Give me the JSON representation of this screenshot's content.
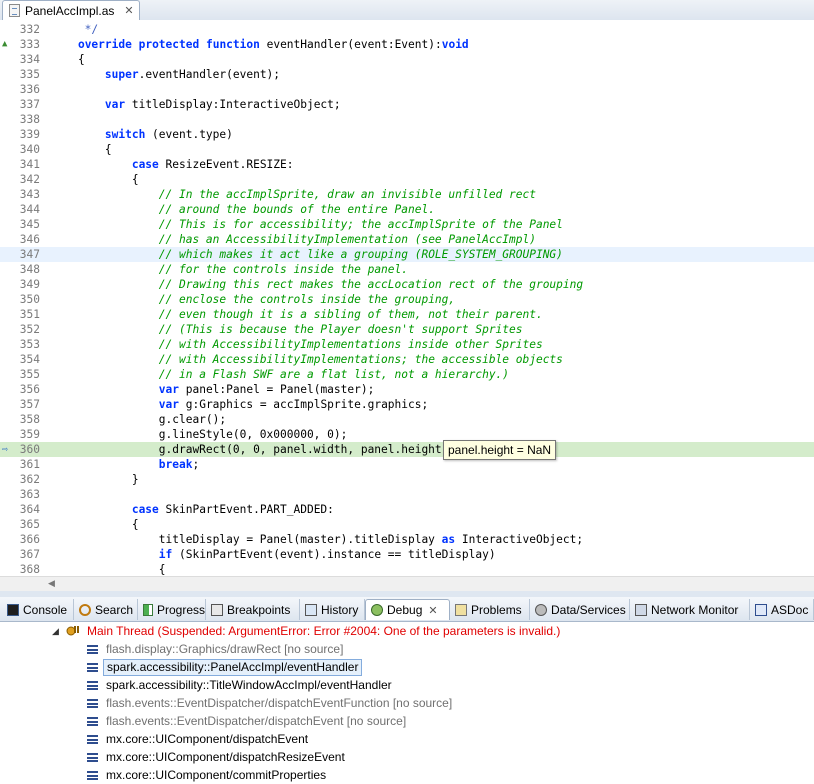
{
  "editor_tab": {
    "title": "PanelAccImpl.as",
    "close": "✕"
  },
  "code_lines": [
    {
      "num": "332",
      "text": "     */"
    },
    {
      "num": "333",
      "text": "    override protected function eventHandler(event:Event):void"
    },
    {
      "num": "334",
      "text": "    {"
    },
    {
      "num": "335",
      "text": "        super.eventHandler(event);"
    },
    {
      "num": "336",
      "text": ""
    },
    {
      "num": "337",
      "text": "        var titleDisplay:InteractiveObject;"
    },
    {
      "num": "338",
      "text": ""
    },
    {
      "num": "339",
      "text": "        switch (event.type)"
    },
    {
      "num": "340",
      "text": "        {"
    },
    {
      "num": "341",
      "text": "            case ResizeEvent.RESIZE:"
    },
    {
      "num": "342",
      "text": "            {"
    },
    {
      "num": "343",
      "text": "                // In the accImplSprite, draw an invisible unfilled rect"
    },
    {
      "num": "344",
      "text": "                // around the bounds of the entire Panel."
    },
    {
      "num": "345",
      "text": "                // This is for accessibility; the accImplSprite of the Panel"
    },
    {
      "num": "346",
      "text": "                // has an AccessibilityImplementation (see PanelAccImpl)"
    },
    {
      "num": "347",
      "text": "                // which makes it act like a grouping (ROLE_SYSTEM_GROUPING)"
    },
    {
      "num": "348",
      "text": "                // for the controls inside the panel."
    },
    {
      "num": "349",
      "text": "                // Drawing this rect makes the accLocation rect of the grouping"
    },
    {
      "num": "350",
      "text": "                // enclose the controls inside the grouping,"
    },
    {
      "num": "351",
      "text": "                // even though it is a sibling of them, not their parent."
    },
    {
      "num": "352",
      "text": "                // (This is because the Player doesn't support Sprites"
    },
    {
      "num": "353",
      "text": "                // with AccessibilityImplementations inside other Sprites"
    },
    {
      "num": "354",
      "text": "                // with AccessibilityImplementations; the accessible objects"
    },
    {
      "num": "355",
      "text": "                // in a Flash SWF are a flat list, not a hierarchy.)"
    },
    {
      "num": "356",
      "text": "                var panel:Panel = Panel(master);"
    },
    {
      "num": "357",
      "text": "                var g:Graphics = accImplSprite.graphics;"
    },
    {
      "num": "358",
      "text": "                g.clear();"
    },
    {
      "num": "359",
      "text": "                g.lineStyle(0, 0x000000, 0);"
    },
    {
      "num": "360",
      "text": "                g.drawRect(0, 0, panel.width, panel.height);"
    },
    {
      "num": "361",
      "text": "                break;"
    },
    {
      "num": "362",
      "text": "            }"
    },
    {
      "num": "363",
      "text": ""
    },
    {
      "num": "364",
      "text": "            case SkinPartEvent.PART_ADDED:"
    },
    {
      "num": "365",
      "text": "            {"
    },
    {
      "num": "366",
      "text": "                titleDisplay = Panel(master).titleDisplay as InteractiveObject;"
    },
    {
      "num": "367",
      "text": "                if (SkinPartEvent(event).instance == titleDisplay)"
    },
    {
      "num": "368",
      "text": "                {"
    }
  ],
  "tooltip": "panel.height = NaN",
  "view_tabs": [
    {
      "label": "Console",
      "icon": "console-icon"
    },
    {
      "label": "Search",
      "icon": "search-icon"
    },
    {
      "label": "Progress",
      "icon": "progress-icon"
    },
    {
      "label": "Breakpoints",
      "icon": "breakpoints-icon"
    },
    {
      "label": "History",
      "icon": "history-icon"
    },
    {
      "label": "Debug",
      "icon": "debug-icon",
      "active": true
    },
    {
      "label": "Problems",
      "icon": "problems-icon"
    },
    {
      "label": "Data/Services",
      "icon": "data-services-icon"
    },
    {
      "label": "Network Monitor",
      "icon": "network-monitor-icon"
    },
    {
      "label": "ASDoc",
      "icon": "asdoc-icon"
    }
  ],
  "debug": {
    "thread": "Main Thread (Suspended: ArgumentError: Error #2004: One of the parameters is invalid.)",
    "thread_color": "#e00000",
    "frames": [
      {
        "label": "flash.display::Graphics/drawRect [no source]",
        "no_source": true
      },
      {
        "label": "spark.accessibility::PanelAccImpl/eventHandler",
        "selected": true
      },
      {
        "label": "spark.accessibility::TitleWindowAccImpl/eventHandler"
      },
      {
        "label": "flash.events::EventDispatcher/dispatchEventFunction [no source]",
        "no_source": true
      },
      {
        "label": "flash.events::EventDispatcher/dispatchEvent [no source]",
        "no_source": true
      },
      {
        "label": "mx.core::UIComponent/dispatchEvent"
      },
      {
        "label": "mx.core::UIComponent/dispatchResizeEvent"
      },
      {
        "label": "mx.core::UIComponent/commitProperties"
      }
    ]
  }
}
